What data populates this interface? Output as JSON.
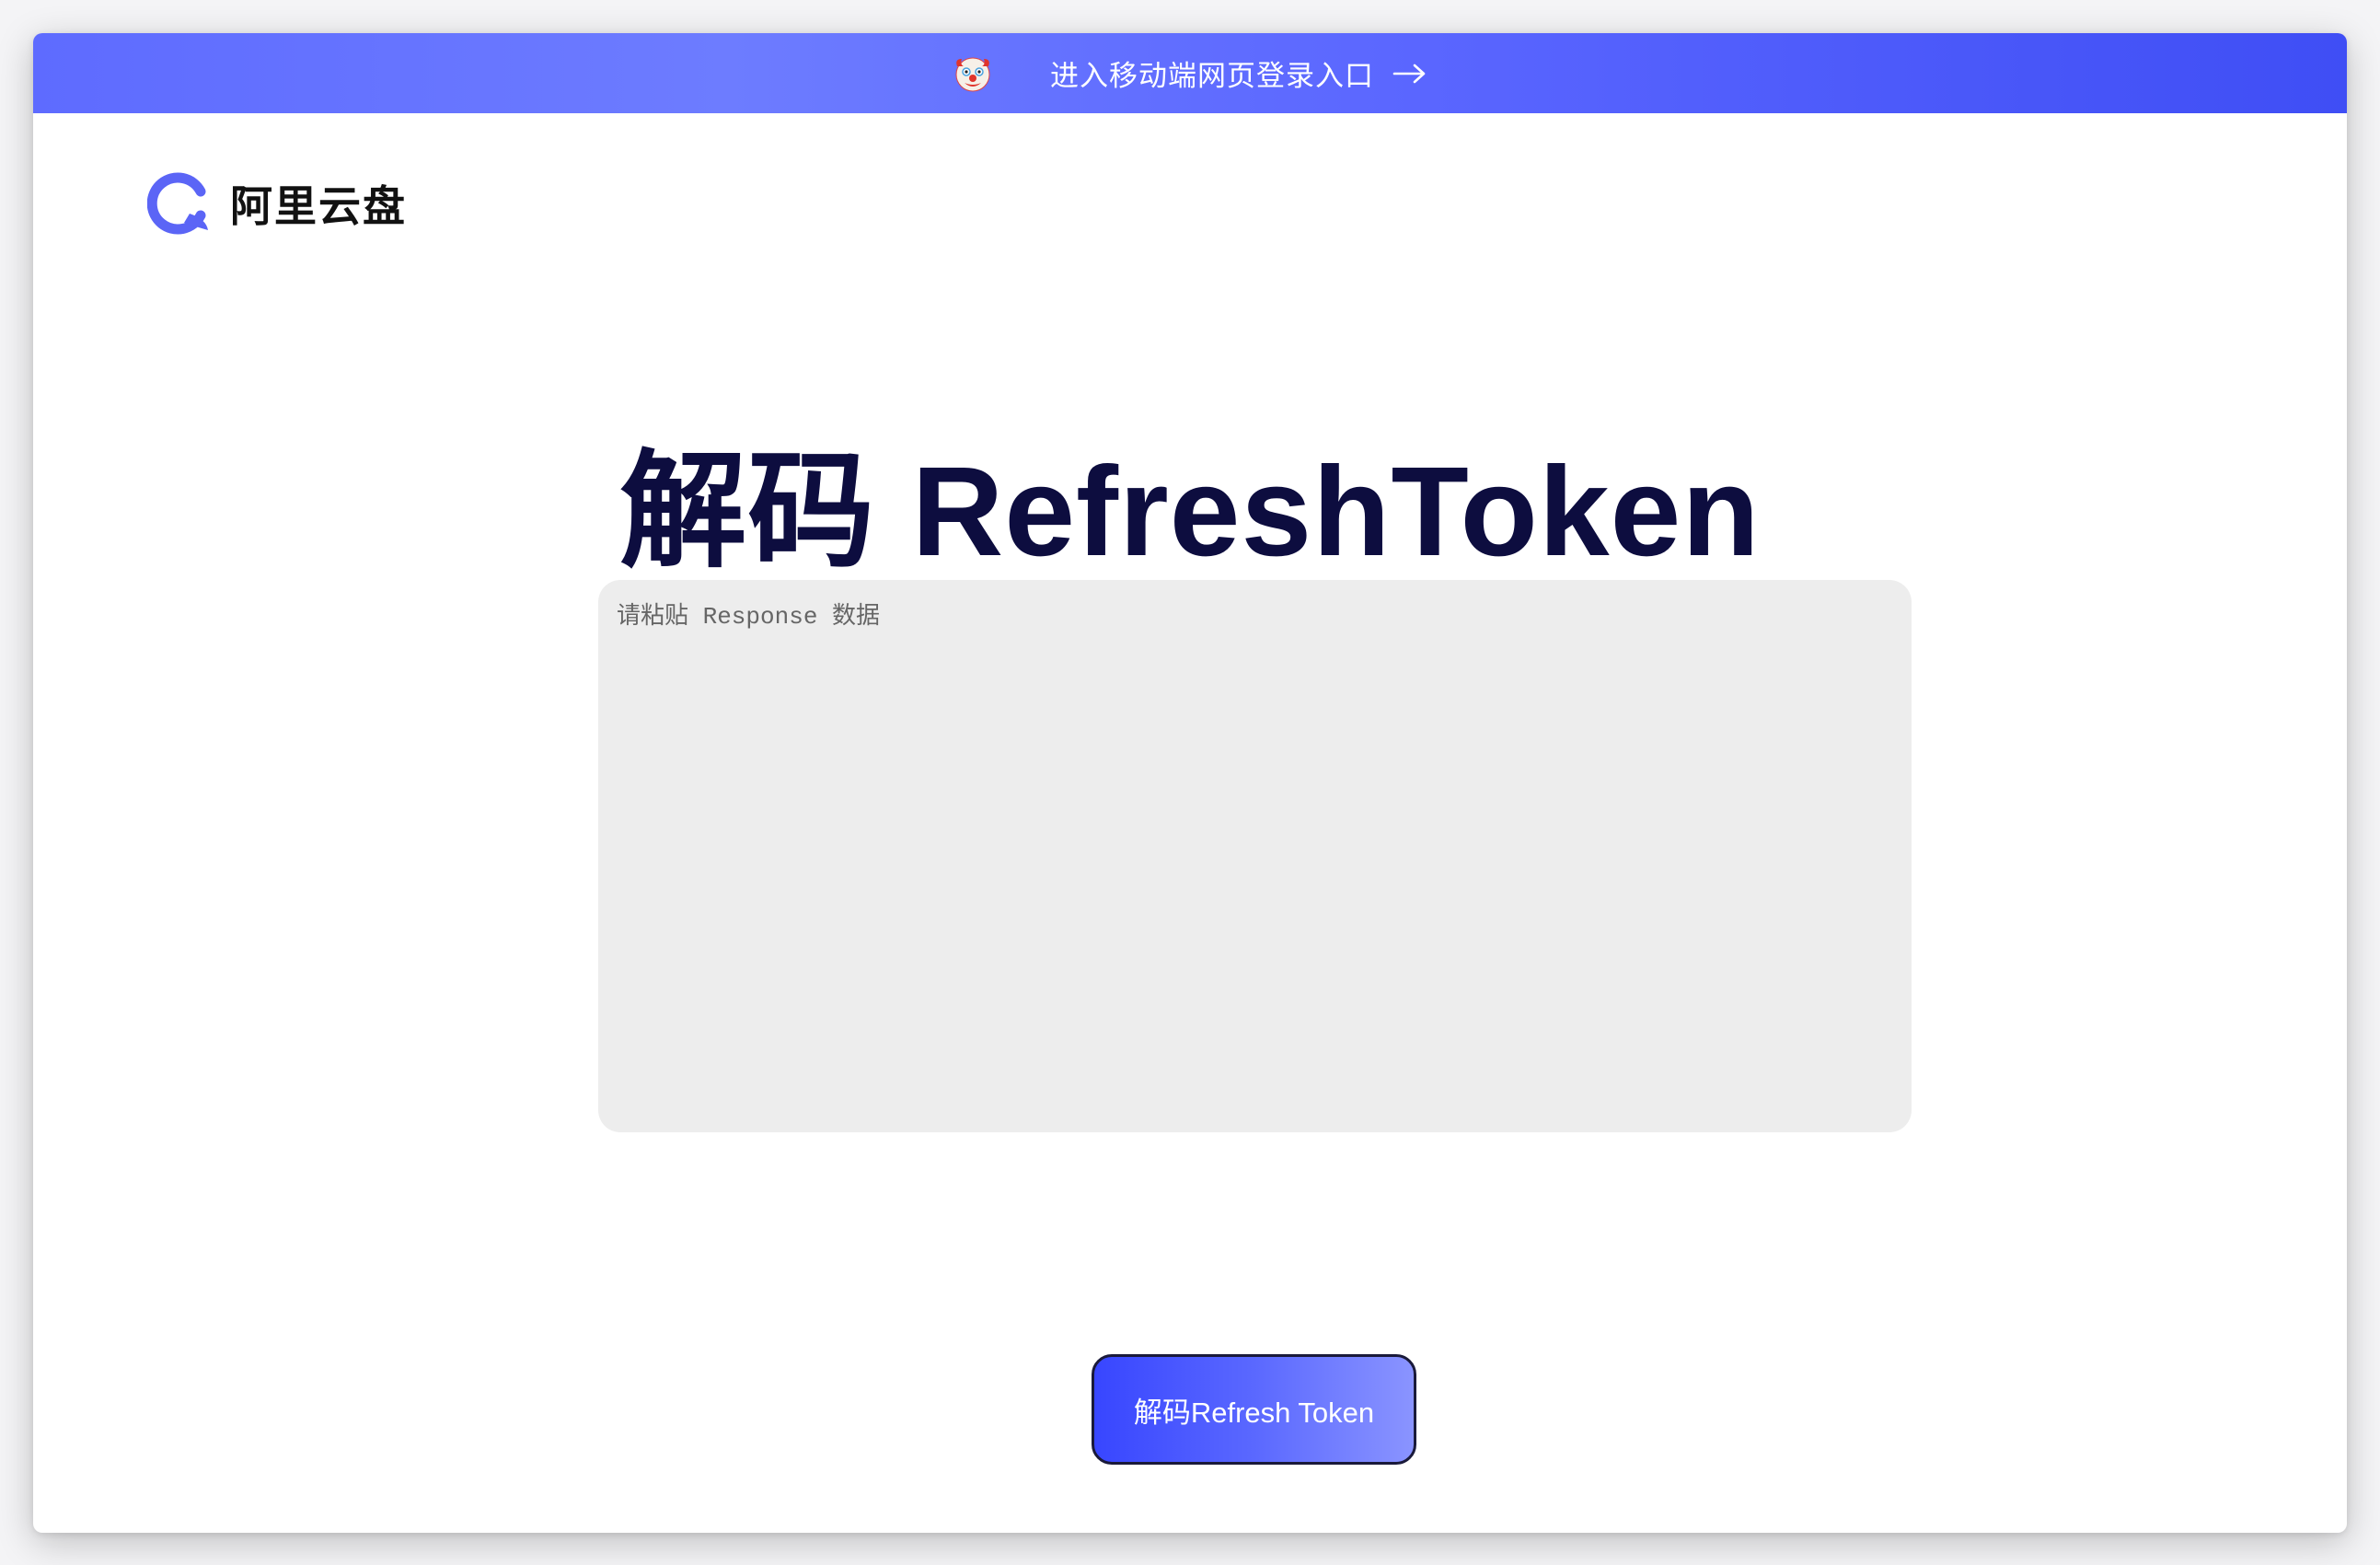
{
  "banner": {
    "emoji_icon": "clown-face-icon",
    "text": "进入移动端网页登录入口",
    "arrow_icon": "arrow-right-icon",
    "colors": {
      "start": "#5e6bff",
      "end": "#3f4ef5"
    }
  },
  "logo": {
    "icon": "aliyun-drive-logo-icon",
    "text": "阿里云盘",
    "color": "#5b65f6"
  },
  "main": {
    "title": "解码 RefreshToken",
    "input": {
      "placeholder": "请粘贴 Response 数据",
      "value": ""
    },
    "decode_button_label": "解码Refresh Token"
  },
  "colors": {
    "title": "#0d0d3f",
    "accent": "#3846ff",
    "input_bg": "#ededed"
  }
}
